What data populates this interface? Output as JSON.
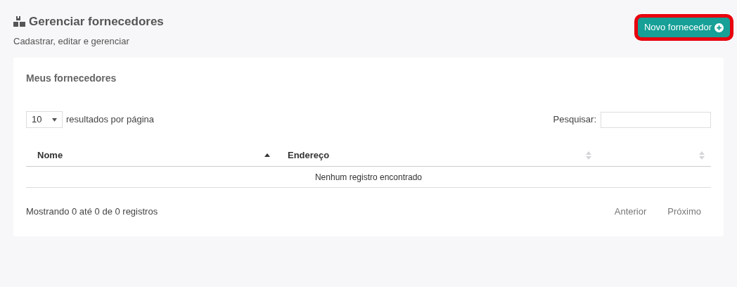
{
  "header": {
    "title": "Gerenciar fornecedores",
    "subtitle": "Cadastrar, editar e gerenciar"
  },
  "new_button": {
    "label": "Novo fornecedor",
    "highlighted": true
  },
  "card": {
    "title": "Meus fornecedores",
    "page_size": {
      "value": "10",
      "label": "resultados por página"
    },
    "search": {
      "label": "Pesquisar:"
    },
    "table": {
      "columns": [
        {
          "label": "Nome",
          "sorted": true
        },
        {
          "label": "Endereço",
          "sorted": false
        },
        {
          "sorted": false
        }
      ],
      "empty_message": "Nenhum registro encontrado"
    },
    "info": "Mostrando 0 até 0 de 0 registros",
    "pagination": [
      {
        "label": "Anterior",
        "disabled": true
      },
      {
        "label": "Próximo",
        "disabled": true
      }
    ]
  }
}
